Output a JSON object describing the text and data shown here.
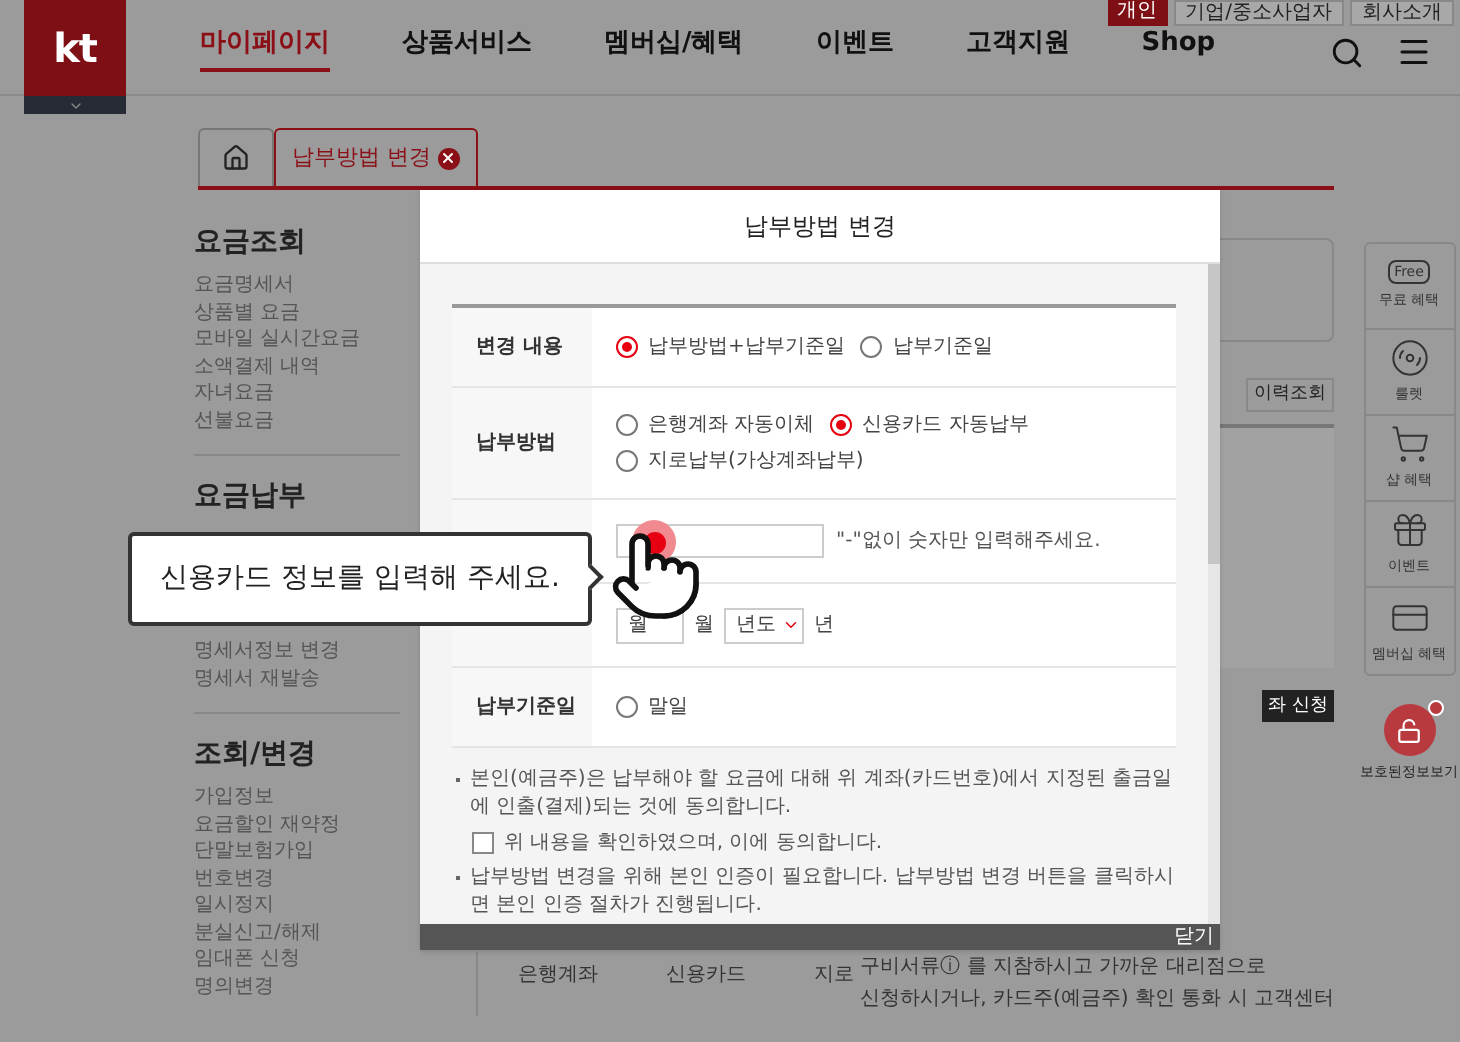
{
  "header": {
    "logo": "kt",
    "top_links": [
      {
        "label": "개인",
        "selected": true
      },
      {
        "label": "기업/중소사업자",
        "selected": false
      },
      {
        "label": "회사소개",
        "selected": false
      }
    ],
    "nav": [
      {
        "label": "마이페이지",
        "selected": true
      },
      {
        "label": "상품서비스",
        "selected": false
      },
      {
        "label": "멤버십/혜택",
        "selected": false
      },
      {
        "label": "이벤트",
        "selected": false
      },
      {
        "label": "고객지원",
        "selected": false
      },
      {
        "label": "Shop",
        "selected": false
      }
    ]
  },
  "tabs": [
    {
      "kind": "home",
      "selected": false
    },
    {
      "kind": "text",
      "label": "납부방법 변경",
      "selected": true
    }
  ],
  "sidebar": [
    {
      "title": "요금조회",
      "items": [
        "요금명세서",
        "상품별 요금",
        "모바일 실시간요금",
        "소액결제 내역",
        "자녀요금",
        "선불요금"
      ]
    },
    {
      "title": "요금납부",
      "items": [
        "명세서정보 변경",
        "명세서 재발송"
      ]
    },
    {
      "title": "조회/변경",
      "items": [
        "가입정보",
        "요금할인 재약정",
        "단말보험가입",
        "번호변경",
        "일시정지",
        "분실신고/해제",
        "임대폰 신청",
        "명의변경"
      ]
    }
  ],
  "background": {
    "history_button": "이력조회",
    "apply_button": "좌 신청",
    "table_cells": [
      "은행계좌",
      "신용카드",
      "지로"
    ],
    "note_lines": [
      "구비서류ⓘ 를 지참하시고 가까운 대리점으로",
      "신청하시거나, 카드주(예금주) 확인 통화 시 고객센터"
    ]
  },
  "quick_menu": [
    {
      "kind": "free",
      "icon_text": "Free",
      "label": "무료 혜택"
    },
    {
      "kind": "roulette",
      "label": "룰렛"
    },
    {
      "kind": "shop",
      "label": "샵 혜택"
    },
    {
      "kind": "event",
      "label": "이벤트"
    },
    {
      "kind": "membership",
      "label": "멤버십 혜택"
    }
  ],
  "protected_info": {
    "label": "보호된정보보기"
  },
  "modal": {
    "title": "납부방법 변경",
    "rows": [
      {
        "kind": "radio",
        "label": "변경 내용",
        "options": [
          {
            "label": "납부방법+납부기준일",
            "selected": true
          },
          {
            "label": "납부기준일",
            "selected": false
          }
        ]
      },
      {
        "kind": "radio",
        "label": "납부방법",
        "options": [
          {
            "label": "은행계좌 자동이체",
            "selected": false
          },
          {
            "label": "신용카드 자동납부",
            "selected": true
          },
          {
            "label": "지로납부(가상계좌납부)",
            "selected": false
          }
        ]
      },
      {
        "kind": "input",
        "hint": "\"-\"없이 숫자만 입력해주세요."
      },
      {
        "kind": "expiry",
        "month_select": "월",
        "month_unit": "월",
        "year_select": "년도",
        "year_unit": "년"
      },
      {
        "kind": "radio",
        "label": "납부기준일",
        "options": [
          {
            "label": "말일",
            "selected": false
          }
        ]
      }
    ],
    "notes": [
      {
        "kind": "bullet",
        "text": "본인(예금주)은 납부해야 할 요금에 대해 위 계좌(카드번호)에서 지정된 출금일에 인출(결제)되는 것에 동의합니다."
      },
      {
        "kind": "checkbox",
        "text": "위 내용을 확인하였으며, 이에 동의합니다.",
        "checked": false
      },
      {
        "kind": "bullet",
        "text": "납부방법 변경을 위해 본인 인증이 필요합니다. 납부방법 변경 버튼을 클릭하시면 본인 인증 절차가 진행됩니다."
      }
    ],
    "close_button": "닫기"
  },
  "tooltip": {
    "text": "신용카드 정보를 입력해 주세요."
  }
}
